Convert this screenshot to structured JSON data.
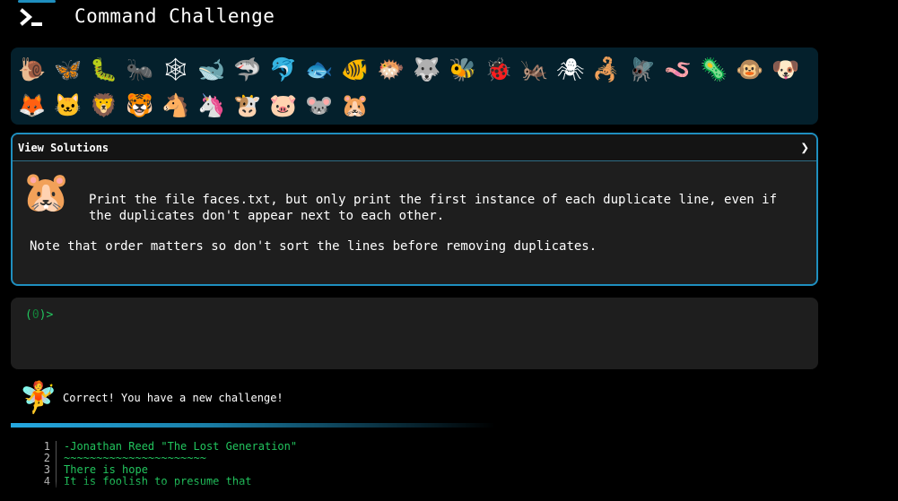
{
  "header": {
    "title": "Command Challenge",
    "logo_icon": "terminal-prompt-icon"
  },
  "emojis": [
    "🐌",
    "🦋",
    "🐛",
    "🐜",
    "🕸",
    "🐋",
    "🦈",
    "🐬",
    "🐟",
    "🐠",
    "🐡",
    "🐺",
    "🐝",
    "🐞",
    "🦗",
    "🕷",
    "🦂",
    "🪰",
    "🪱",
    "🦠",
    "🐵",
    "🐶",
    "🦊",
    "🐱",
    "🦁",
    "🐯",
    "🐴",
    "🦄",
    "🐮",
    "🐷",
    "🐭",
    "🐹"
  ],
  "challenge": {
    "solutions_label": "View Solutions",
    "expand_icon": "chevron-right-icon",
    "avatar": "🐹",
    "prompt": "Print the file faces.txt, but only print the first instance of each duplicate line, even if the duplicates don't appear next to each other.",
    "note": "Note that order matters so don't sort the lines before removing duplicates."
  },
  "terminal": {
    "prompt_open": "(",
    "exit_code": "0",
    "prompt_close": ")>",
    "input": ""
  },
  "feedback": {
    "avatar": "🧚",
    "message": "Correct! You have a new challenge!"
  },
  "output": {
    "lines": [
      {
        "n": "1",
        "text": "-Jonathan Reed \"The Lost Generation\""
      },
      {
        "n": "2",
        "text": "~~~~~~~~~~~~~~~~~~~~~~"
      },
      {
        "n": "3",
        "text": "There is hope"
      },
      {
        "n": "4",
        "text": "It is foolish to presume that"
      }
    ]
  },
  "colors": {
    "accent": "#1f8fbf",
    "prompt_green": "#22c55e",
    "panel": "#1e1e1e",
    "emoji_bar": "#04202c"
  }
}
